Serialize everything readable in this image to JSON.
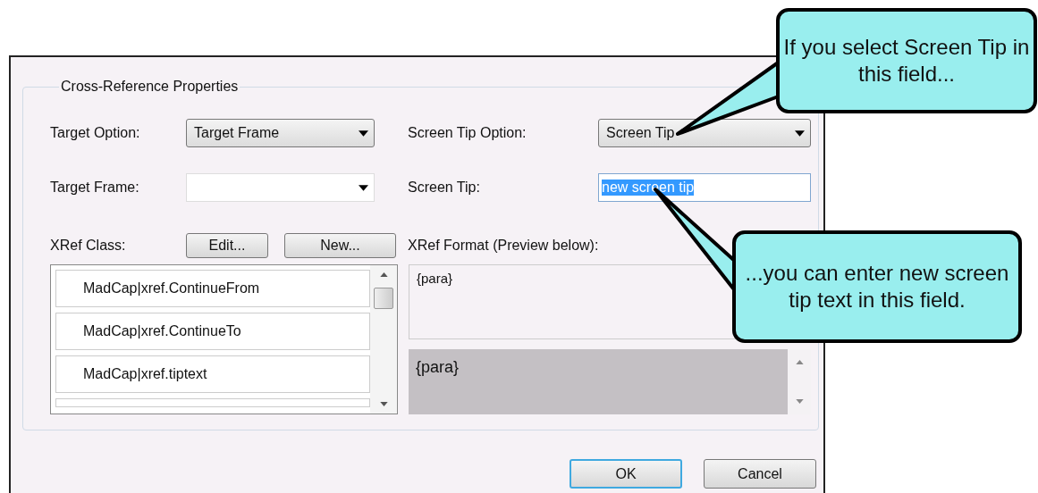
{
  "dialog": {
    "group_title": "Cross-Reference Properties",
    "target_option": {
      "label": "Target Option:",
      "value": "Target Frame"
    },
    "target_frame": {
      "label": "Target Frame:"
    },
    "screen_tip_option": {
      "label": "Screen Tip Option:",
      "value": "Screen Tip"
    },
    "screen_tip": {
      "label": "Screen Tip:",
      "value": "new screen tip",
      "text_selected": true
    },
    "xref_class": {
      "label": "XRef Class:",
      "buttons": [
        "Edit...",
        "New..."
      ],
      "items": [
        {
          "label": "MadCap|xref.ContinueFrom"
        },
        {
          "label": "MadCap|xref.ContinueTo"
        },
        {
          "label": "MadCap|xref.tiptext"
        }
      ]
    },
    "xref_format": {
      "label": "XRef Format (Preview below):",
      "value": "{para}",
      "preview": "{para}"
    },
    "buttons": [
      {
        "label": "OK",
        "default": true
      },
      {
        "label": "Cancel",
        "default": false
      }
    ]
  },
  "callouts": [
    {
      "text": "If you select Screen Tip in this field..."
    },
    {
      "text": "...you can enter new screen tip text in this field."
    }
  ]
}
